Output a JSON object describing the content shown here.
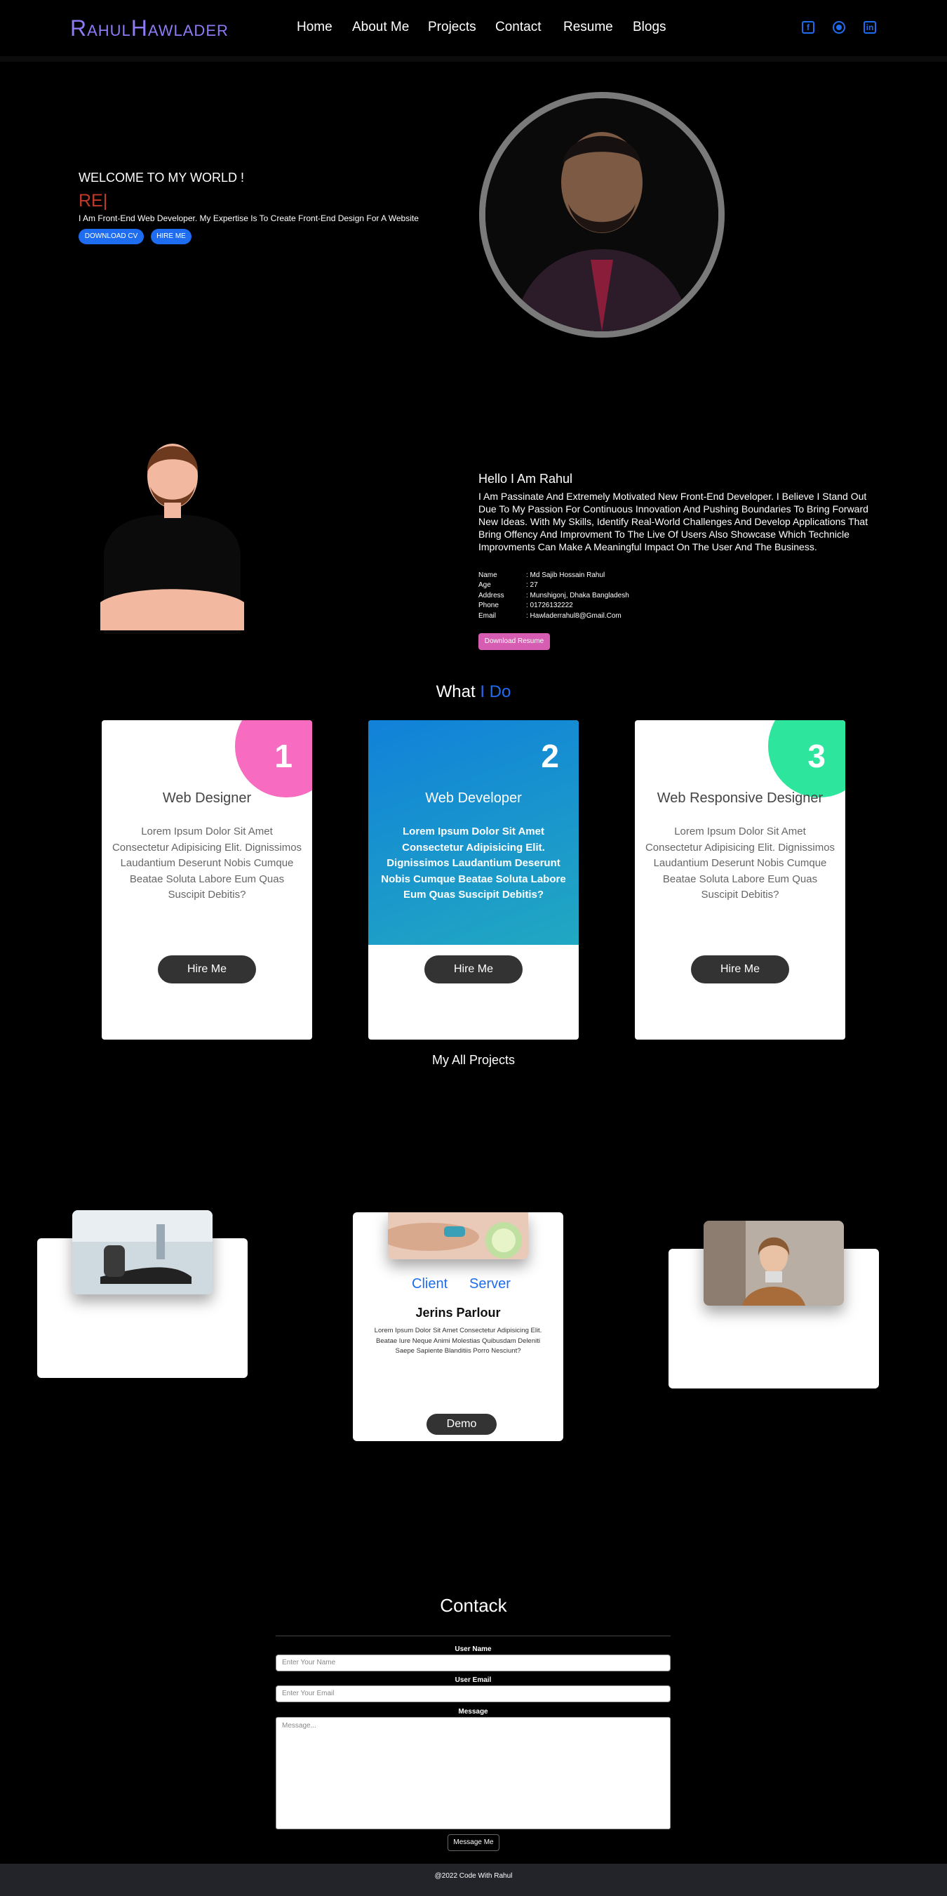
{
  "nav": {
    "logo": "RahulHawlader",
    "links": [
      "Home",
      "About Me",
      "Projects",
      "Contact",
      "Resume",
      "Blogs"
    ],
    "social_icons": [
      "facebook-icon",
      "github-icon",
      "linkedin-icon"
    ]
  },
  "hero": {
    "welcome": "WELCOME TO MY WORLD !",
    "typed": "RE|",
    "tagline": "I Am Front-End Web Developer. My Expertise Is To Create Front-End Design For A Website",
    "btn_cv": "DOWNLOAD CV",
    "btn_hire": "HIRE ME"
  },
  "about": {
    "hello": "Hello I Am Rahul",
    "text": "I Am Passinate And Extremely Motivated New Front-End Developer. I Believe I Stand Out Due To My Passion For Continuous Innovation And Pushing Boundaries To Bring Forward New Ideas. With My Skills, Identify Real-World Challenges And Develop Applications That Bring Offency And Improvment To The Live Of Users Also Showcase Which Technicle Improvments Can Make A Meaningful Impact On The User And The Business.",
    "info": [
      {
        "k": "Name",
        "v": ": Md Sajib Hossain Rahul"
      },
      {
        "k": "Age",
        "v": ": 27"
      },
      {
        "k": "Address",
        "v": ": Munshigonj, Dhaka Bangladesh"
      },
      {
        "k": "Phone",
        "v": ": 01726132222"
      },
      {
        "k": "Email",
        "v": ": Hawladerrahul8@Gmail.Com"
      }
    ],
    "resume_btn": "Download Resume"
  },
  "services": {
    "title_a": "What ",
    "title_b": "I Do",
    "cards": [
      {
        "num": "1",
        "title": "Web Designer",
        "desc": "Lorem Ipsum Dolor Sit Amet Consectetur Adipisicing Elit. Dignissimos Laudantium Deserunt Nobis Cumque Beatae Soluta Labore Eum Quas Suscipit Debitis?",
        "btn": "Hire Me",
        "accent": "#f76bc0"
      },
      {
        "num": "2",
        "title": "Web Developer",
        "desc": "Lorem Ipsum Dolor Sit Amet Consectetur Adipisicing Elit. Dignissimos Laudantium Deserunt Nobis Cumque Beatae Soluta Labore Eum Quas Suscipit Debitis?",
        "btn": "Hire Me",
        "accent": "#1181d9"
      },
      {
        "num": "3",
        "title": "Web Responsive Designer",
        "desc": "Lorem Ipsum Dolor Sit Amet Consectetur Adipisicing Elit. Dignissimos Laudantium Deserunt Nobis Cumque Beatae Soluta Labore Eum Quas Suscipit Debitis?",
        "btn": "Hire Me",
        "accent": "#2ee59d"
      }
    ]
  },
  "projects": {
    "title": "My All Projects",
    "client": "Client",
    "server": "Server",
    "name": "Jerins Parlour",
    "desc": "Lorem Ipsum Dolor Sit Amet Consectetur Adipisicing Elit. Beatae Iure Neque Animi Molestias Quibusdam Deleniti Saepe Sapiente Blanditiis Porro Nesciunt?",
    "demo": "Demo"
  },
  "contact": {
    "title": "Contack",
    "name_label": "User Name",
    "name_placeholder": "Enter Your Name",
    "email_label": "User Email",
    "email_placeholder": "Enter Your Email",
    "msg_label": "Message",
    "msg_placeholder": "Message...",
    "btn": "Message Me"
  },
  "footer": {
    "text": "@2022 Code With Rahul"
  }
}
